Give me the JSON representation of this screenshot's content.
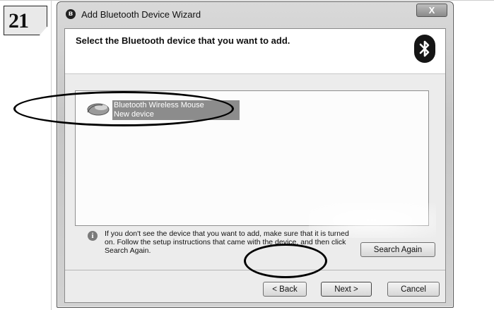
{
  "step_number": "21",
  "window": {
    "title": "Add Bluetooth Device Wizard",
    "close_label": "X"
  },
  "header": {
    "heading": "Select the Bluetooth device that you want to add."
  },
  "devices": [
    {
      "name": "Bluetooth Wireless Mouse",
      "status": "New device",
      "icon": "mouse-icon",
      "selected": true
    }
  ],
  "info": {
    "text": "If you don't see the device that you want to add, make sure that it is turned on. Follow the setup instructions that came with the device, and then click Search Again."
  },
  "buttons": {
    "search_again": "Search Again",
    "back": "< Back",
    "next": "Next >",
    "cancel": "Cancel"
  }
}
